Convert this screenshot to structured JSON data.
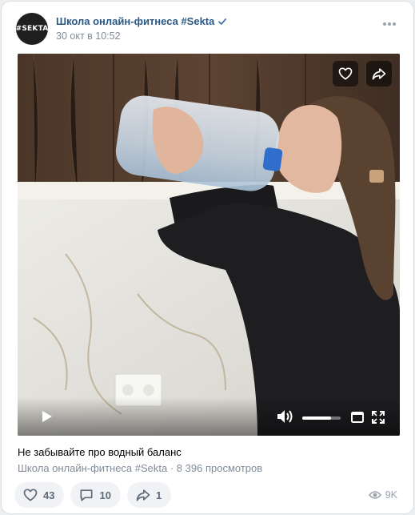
{
  "post": {
    "author": "Школа онлайн-фитнеса #Sekta",
    "avatar_text": "#SEKTA",
    "date": "30 окт в 10:52",
    "caption": "Не забывайте про водный баланс",
    "meta": "Школа онлайн-фитнеса #Sekta · 8 396 просмотров"
  },
  "video": {
    "volume_level": 0.75
  },
  "actions": {
    "likes": "43",
    "comments": "10",
    "reposts": "1",
    "views": "9K"
  },
  "icons": {
    "verified": "verified-icon",
    "more": "more-dots-icon",
    "like": "heart-icon",
    "share": "share-arrow-icon",
    "comment": "comment-icon",
    "play": "play-icon",
    "volume": "volume-icon",
    "miniplayer": "miniplayer-icon",
    "fullscreen": "fullscreen-icon",
    "views": "eye-icon"
  },
  "colors": {
    "link": "#2a5885",
    "muted": "#818c99",
    "verified": "#4a76a8",
    "button_bg": "#f0f2f5"
  }
}
